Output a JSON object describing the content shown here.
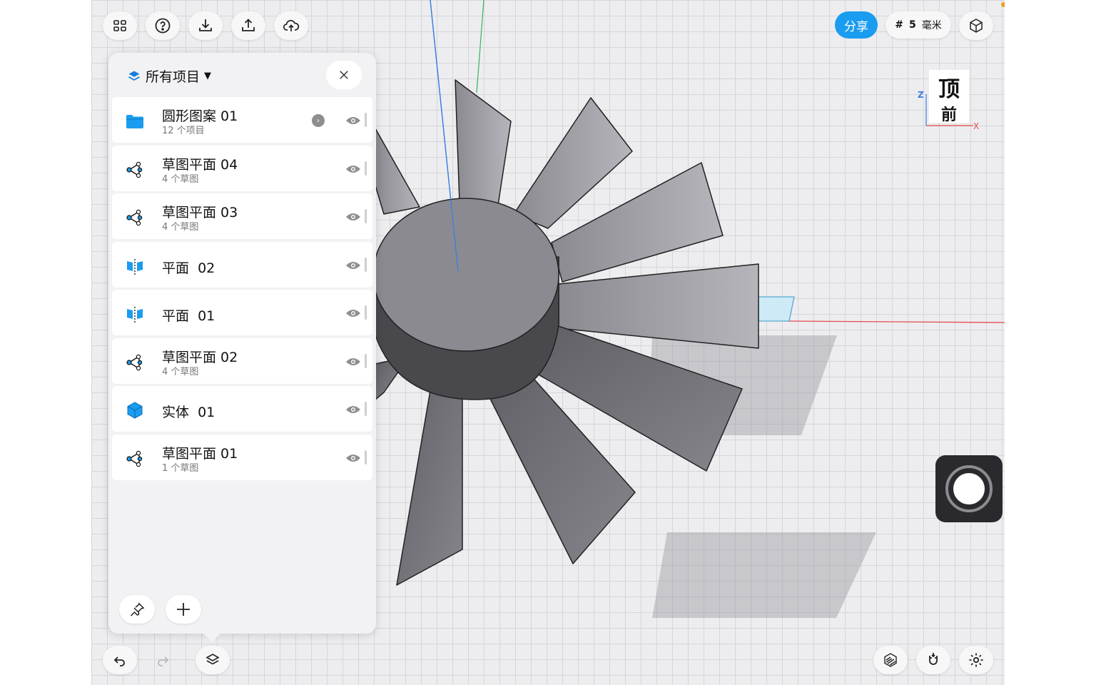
{
  "toolbar": {
    "share_label": "分享",
    "grid_hash": "#",
    "grid_value": "5",
    "grid_unit": "毫米"
  },
  "viewcube": {
    "top_label": "顶",
    "front_label": "前",
    "axis_z": "Z",
    "axis_x": "X"
  },
  "panel": {
    "title": "所有项目",
    "items": [
      {
        "name": "圆形图案 01",
        "sub": "12 个项目",
        "icon": "folder-icon"
      },
      {
        "name": "草图平面 04",
        "sub": "4 个草图",
        "icon": "sketch-icon"
      },
      {
        "name": "草图平面 03",
        "sub": "4 个草图",
        "icon": "sketch-icon"
      },
      {
        "name": "平面  02",
        "sub": "",
        "icon": "plane-icon"
      },
      {
        "name": "平面  01",
        "sub": "",
        "icon": "plane-icon"
      },
      {
        "name": "草图平面 02",
        "sub": "4 个草图",
        "icon": "sketch-icon"
      },
      {
        "name": "实体  01",
        "sub": "",
        "icon": "solid-cube-icon"
      },
      {
        "name": "草图平面 01",
        "sub": "1 个草图",
        "icon": "sketch-icon"
      }
    ]
  },
  "colors": {
    "accent": "#1a9cf0",
    "model": "#7a7a80",
    "axis_x": "#e44b4b",
    "axis_y": "#3fb964",
    "axis_z": "#3b7fe0"
  }
}
